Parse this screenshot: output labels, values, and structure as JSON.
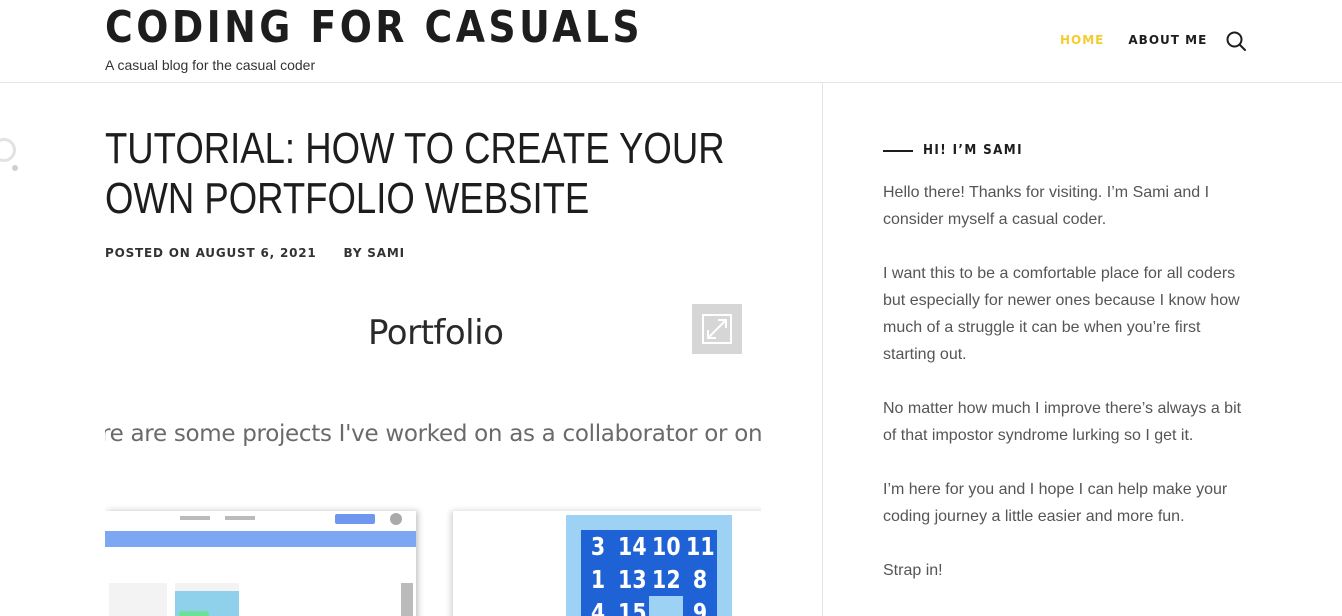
{
  "header": {
    "site_title": "CODING FOR CASUALS",
    "tagline": "A casual blog for the casual coder",
    "nav": [
      {
        "label": "HOME",
        "active": true
      },
      {
        "label": "ABOUT ME",
        "active": false
      }
    ],
    "search_icon": "search-icon",
    "accent_color": "#f5cb30"
  },
  "post": {
    "title": "TUTORIAL: HOW TO CREATE YOUR OWN PORTFOLIO WEBSITE",
    "meta_posted_prefix": "POSTED ON",
    "meta_date": "AUGUST 6, 2021",
    "meta_by_prefix": "BY",
    "meta_author": "SAMI"
  },
  "featured_image": {
    "heading": "Portfolio",
    "description": "re are some projects I've worked on as a collaborator or on my o",
    "expand_icon": "expand-icon",
    "puzzle_rows": [
      [
        "3",
        "14",
        "10",
        "11"
      ],
      [
        "1",
        "13",
        "12",
        "8"
      ],
      [
        "4",
        "15",
        "",
        "9"
      ]
    ]
  },
  "sidebar": {
    "widget_title": "HI! I’M SAMI",
    "paragraphs": [
      "Hello there! Thanks for visiting. I’m Sami and I consider myself a casual coder.",
      "I want this to be a comfortable place for all coders but especially for newer ones because I know how much of a struggle it can be when you’re first starting out.",
      "No matter how much I improve there’s always a bit of that impostor syndrome lurking so I get it.",
      "I’m here for you and I hope I can help make your coding journey a little easier and more fun.",
      "Strap in!"
    ]
  }
}
